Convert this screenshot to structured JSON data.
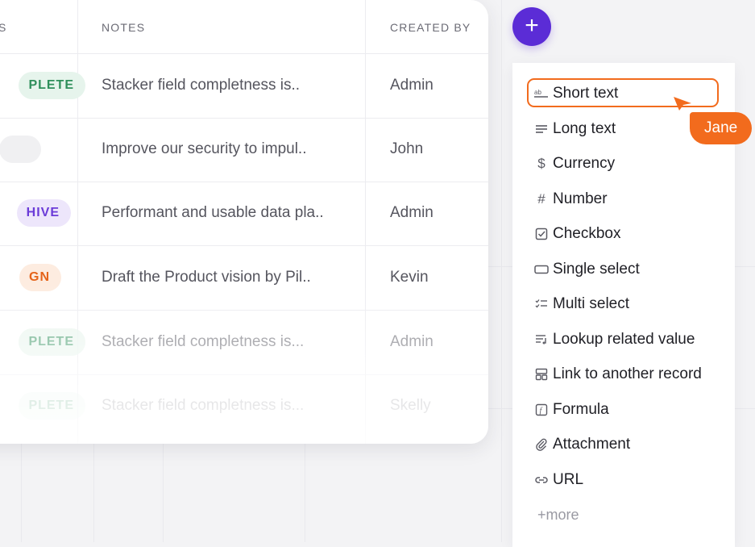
{
  "table": {
    "headers": {
      "status": "S",
      "notes": "NOTES",
      "created_by": "CREATED BY"
    },
    "rows": [
      {
        "status": "PLETE",
        "status_color": "#2f8f5b",
        "status_bg": "#e6f4ec",
        "note": "Stacker field completness is..",
        "created_by": "Admin"
      },
      {
        "status": "",
        "status_color": "#6b6b75",
        "status_bg": "#f0f0f2",
        "note": "Improve our security to impul..",
        "created_by": "John"
      },
      {
        "status": "HIVE",
        "status_color": "#6b3bd8",
        "status_bg": "#ede6fb",
        "note": "Performant and usable data pla..",
        "created_by": "Admin"
      },
      {
        "status": "GN",
        "status_color": "#e5641a",
        "status_bg": "#fdece0",
        "note": "Draft the Product vision by Pil..",
        "created_by": "Kevin"
      },
      {
        "status": "PLETE",
        "status_color": "#2f8f5b",
        "status_bg": "#e6f4ec",
        "note": "Stacker field completness is...",
        "created_by": "Admin"
      },
      {
        "status": "PLETE",
        "status_color": "#2f8f5b",
        "status_bg": "#e6f4ec",
        "note": "Stacker field completness is...",
        "created_by": "Skelly"
      }
    ]
  },
  "add_button": {
    "label": "+",
    "color": "#5b2cd6"
  },
  "field_menu": {
    "selected_index": 0,
    "items": [
      {
        "label": "Short text",
        "icon": "short-text-icon"
      },
      {
        "label": "Long text",
        "icon": "long-text-icon"
      },
      {
        "label": "Currency",
        "icon": "dollar-icon"
      },
      {
        "label": "Number",
        "icon": "hash-icon"
      },
      {
        "label": "Checkbox",
        "icon": "checkbox-icon"
      },
      {
        "label": "Single select",
        "icon": "single-select-icon"
      },
      {
        "label": "Multi select",
        "icon": "multi-select-icon"
      },
      {
        "label": "Lookup related value",
        "icon": "lookup-icon"
      },
      {
        "label": "Link to another record",
        "icon": "link-record-icon"
      },
      {
        "label": "Formula",
        "icon": "formula-icon"
      },
      {
        "label": "Attachment",
        "icon": "paperclip-icon"
      },
      {
        "label": "URL",
        "icon": "link-icon"
      }
    ],
    "more_label": "+more"
  },
  "collaborator": {
    "name": "Jane",
    "color": "#f26b1d"
  }
}
